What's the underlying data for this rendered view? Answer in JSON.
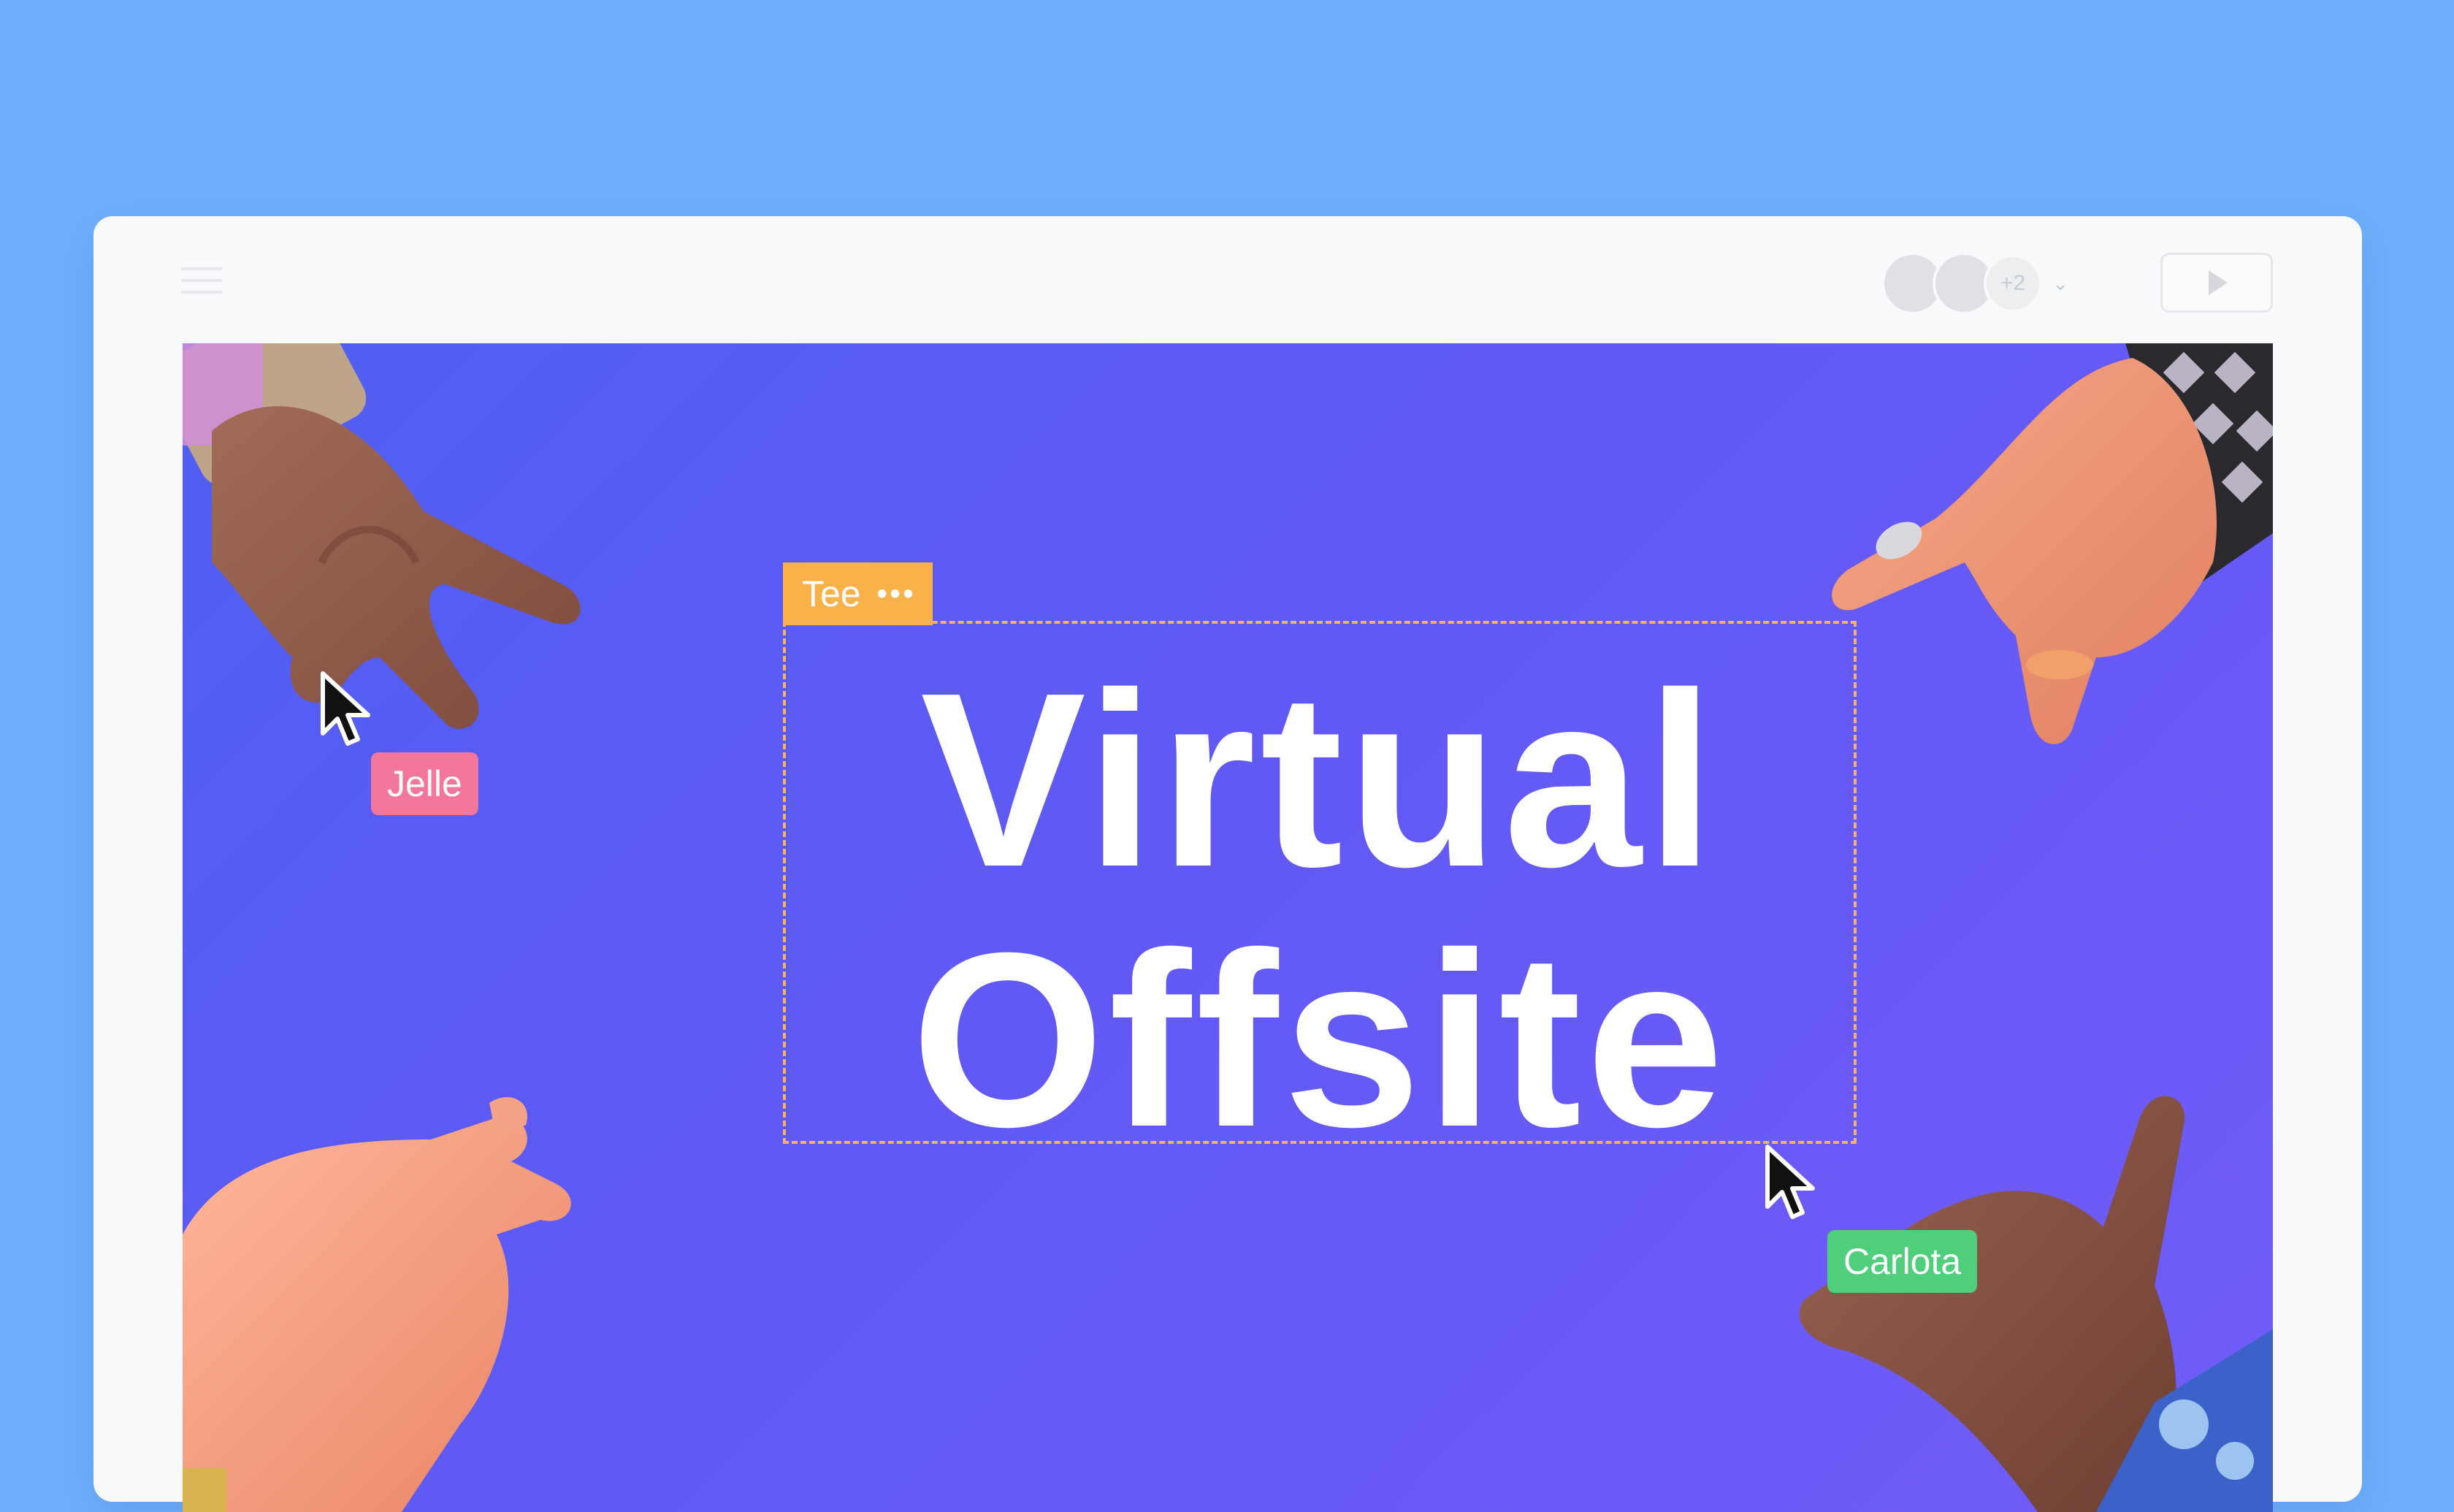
{
  "toolbar": {
    "menu_icon": "hamburger-menu-icon",
    "avatars_more": "+2",
    "play_icon": "play-icon"
  },
  "slide": {
    "title_line1": "Virtual",
    "title_line2": "Offsite",
    "selection_tag": {
      "label": "Tee",
      "more": "•••",
      "color": "#f9b24a"
    },
    "collaborators": [
      {
        "name": "Jelle",
        "color": "#f2779b"
      },
      {
        "name": "Carlota",
        "color": "#4fce7c"
      }
    ],
    "background_colors": [
      "#4f5ff1",
      "#715cf9"
    ]
  }
}
